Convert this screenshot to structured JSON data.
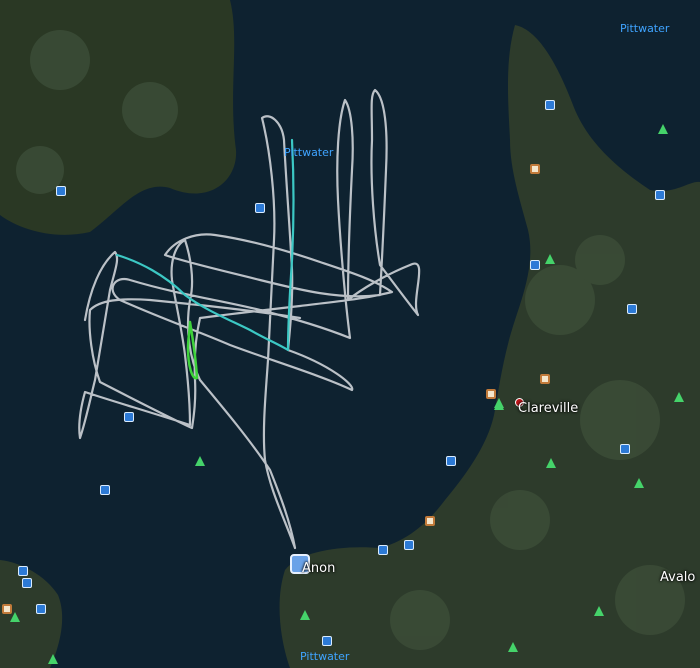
{
  "map": {
    "place_labels": {
      "clareville": "Clareville",
      "anon": "Anon",
      "avalon": "Avalo"
    },
    "water_labels": {
      "pittwater_top_right": "Pittwater",
      "pittwater_center": "Pittwater",
      "pittwater_bottom": "Pittwater"
    },
    "colors": {
      "water": "#0e2230",
      "land": "#2a3a2a",
      "track_main": "#d9dde2",
      "track_highlight": "#3cc8c4",
      "track_recent": "#3ed23a",
      "water_label": "#3fa4ff",
      "tree_icon": "#45d36a"
    },
    "icons": [
      "tree-icon",
      "bed-icon",
      "camera-icon",
      "car-icon",
      "monument-icon",
      "marker-icon"
    ]
  }
}
